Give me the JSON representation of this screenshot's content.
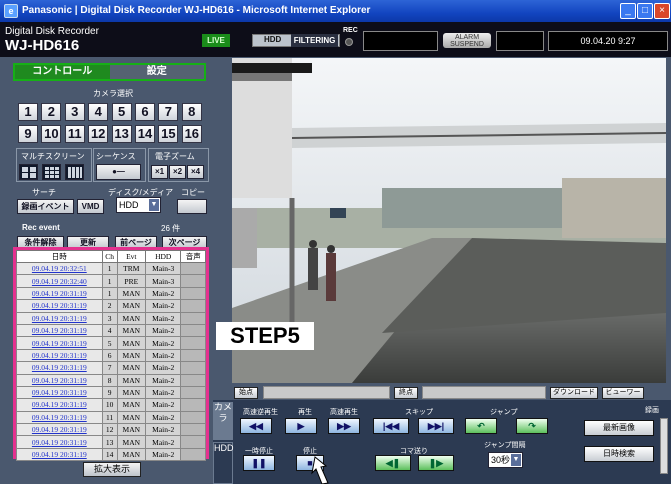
{
  "window": {
    "title": "Panasonic | Digital Disk Recorder WJ-HD616 - Microsoft Internet Explorer"
  },
  "header": {
    "subtitle": "Digital Disk Recorder",
    "model": "WJ-HD616",
    "live": "LIVE",
    "hdd": "HDD",
    "filtering": "FILTERING",
    "rec": "REC",
    "alarm1": "ALARM",
    "alarm2": "SUSPEND",
    "clock": "09.04.20  9:27"
  },
  "tabs": {
    "control": "コントロール",
    "settings": "設定"
  },
  "camera": {
    "label": "カメラ選択",
    "numbers": [
      "1",
      "2",
      "3",
      "4",
      "5",
      "6",
      "7",
      "8",
      "9",
      "10",
      "11",
      "12",
      "13",
      "14",
      "15",
      "16"
    ]
  },
  "sections": {
    "multi": "マルチスクリーン",
    "sequence": "シーケンス",
    "ezoom": "電子ズーム",
    "search": "サーチ",
    "disk": "ディスク/メディア",
    "copy": "コピー",
    "zoom": [
      "×1",
      "×2",
      "×4"
    ]
  },
  "search": {
    "rec_event_btn": "録画イベント",
    "vmd_btn": "VMD",
    "disk_value": "HDD"
  },
  "recevent": {
    "label": "Rec event",
    "count": "26 件",
    "buttons": [
      "条件解除",
      "更新",
      "前ページ",
      "次ページ"
    ]
  },
  "table": {
    "headers": [
      "日時",
      "Ch",
      "Evt",
      "HDD",
      "音声"
    ],
    "rows": [
      [
        "09.04.19 20:32:51",
        "1",
        "TRM",
        "Main-3",
        ""
      ],
      [
        "09.04.19 20:32:40",
        "1",
        "PRE",
        "Main-3",
        ""
      ],
      [
        "09.04.19 20:31:19",
        "1",
        "MAN",
        "Main-2",
        ""
      ],
      [
        "09.04.19 20:31:19",
        "2",
        "MAN",
        "Main-2",
        ""
      ],
      [
        "09.04.19 20:31:19",
        "3",
        "MAN",
        "Main-2",
        ""
      ],
      [
        "09.04.19 20:31:19",
        "4",
        "MAN",
        "Main-2",
        ""
      ],
      [
        "09.04.19 20:31:19",
        "5",
        "MAN",
        "Main-2",
        ""
      ],
      [
        "09.04.19 20:31:19",
        "6",
        "MAN",
        "Main-2",
        ""
      ],
      [
        "09.04.19 20:31:19",
        "7",
        "MAN",
        "Main-2",
        ""
      ],
      [
        "09.04.19 20:31:19",
        "8",
        "MAN",
        "Main-2",
        ""
      ],
      [
        "09.04.19 20:31:19",
        "9",
        "MAN",
        "Main-2",
        ""
      ],
      [
        "09.04.19 20:31:19",
        "10",
        "MAN",
        "Main-2",
        ""
      ],
      [
        "09.04.19 20:31:19",
        "11",
        "MAN",
        "Main-2",
        ""
      ],
      [
        "09.04.19 20:31:19",
        "12",
        "MAN",
        "Main-2",
        ""
      ],
      [
        "09.04.19 20:31:19",
        "13",
        "MAN",
        "Main-2",
        ""
      ],
      [
        "09.04.19 20:31:19",
        "14",
        "MAN",
        "Main-2",
        ""
      ]
    ]
  },
  "enlarge": "拡大表示",
  "step": "STEP5",
  "bar": {
    "start": "始点",
    "end": "終点",
    "download": "ダウンロード",
    "viewer": "ビューワー"
  },
  "vtabs": {
    "camera": "カメラ",
    "hdd": "HDD"
  },
  "playback": {
    "fast_rev": "高速逆再生",
    "play": "再生",
    "fast_fwd": "高速再生",
    "skip": "スキップ",
    "jump": "ジャンプ",
    "pause": "一時停止",
    "stop": "停止",
    "frame": "コマ送り",
    "jump_interval": "ジャンプ間隔",
    "interval_value": "30秒",
    "latest": "最新画像",
    "date_search": "日時検索",
    "record": "録画"
  }
}
